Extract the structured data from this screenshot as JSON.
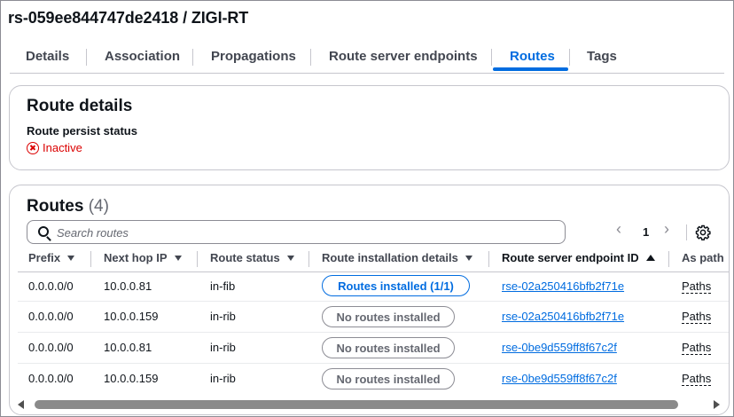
{
  "page": {
    "title": "rs-059ee844747de2418 / ZIGI-RT"
  },
  "tabs": [
    {
      "label": "Details"
    },
    {
      "label": "Association"
    },
    {
      "label": "Propagations"
    },
    {
      "label": "Route server endpoints"
    },
    {
      "label": "Routes",
      "active": true
    },
    {
      "label": "Tags"
    }
  ],
  "route_details": {
    "title": "Route details",
    "field_label": "Route persist status",
    "status": "Inactive"
  },
  "routes": {
    "title": "Routes",
    "count": "(4)",
    "search_placeholder": "Search routes",
    "page": "1",
    "columns": [
      {
        "label": "Prefix"
      },
      {
        "label": "Next hop IP"
      },
      {
        "label": "Route status"
      },
      {
        "label": "Route installation details"
      },
      {
        "label": "Route server endpoint ID"
      },
      {
        "label": "As path"
      }
    ],
    "rows": [
      {
        "prefix": "0.0.0.0/0",
        "next_hop": "10.0.0.81",
        "status": "in-fib",
        "installation": "Routes installed (1/1)",
        "installed": true,
        "endpoint": "rse-02a250416bfb2f71e",
        "as_path": "Paths"
      },
      {
        "prefix": "0.0.0.0/0",
        "next_hop": "10.0.0.159",
        "status": "in-rib",
        "installation": "No routes installed",
        "installed": false,
        "endpoint": "rse-02a250416bfb2f71e",
        "as_path": "Paths"
      },
      {
        "prefix": "0.0.0.0/0",
        "next_hop": "10.0.0.81",
        "status": "in-rib",
        "installation": "No routes installed",
        "installed": false,
        "endpoint": "rse-0be9d559ff8f67c2f",
        "as_path": "Paths"
      },
      {
        "prefix": "0.0.0.0/0",
        "next_hop": "10.0.0.159",
        "status": "in-rib",
        "installation": "No routes installed",
        "installed": false,
        "endpoint": "rse-0be9d559ff8f67c2f",
        "as_path": "Paths"
      }
    ]
  },
  "colors": {
    "accent": "#006ce0",
    "error": "#db0000",
    "text": "#0f141a",
    "muted": "#656871"
  }
}
